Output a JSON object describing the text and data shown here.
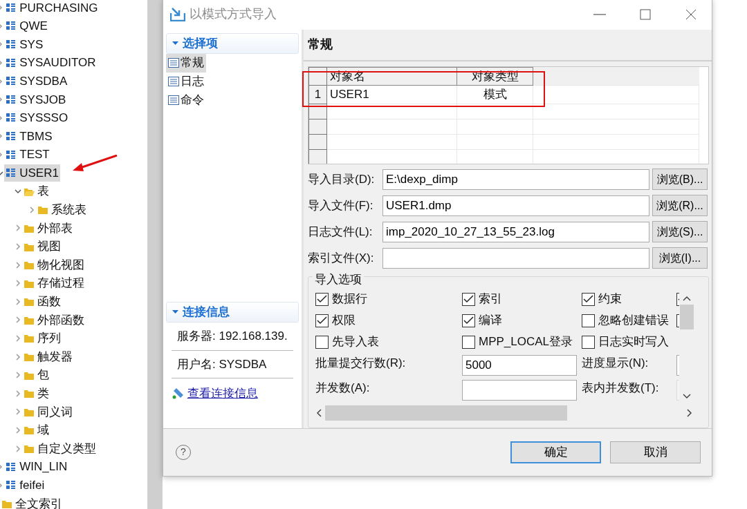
{
  "tree": [
    {
      "label": "PURCHASING",
      "kind": "schema",
      "expanded": false,
      "selected": false
    },
    {
      "label": "QWE",
      "kind": "schema",
      "expanded": false,
      "selected": false
    },
    {
      "label": "SYS",
      "kind": "schema",
      "expanded": false,
      "selected": false
    },
    {
      "label": "SYSAUDITOR",
      "kind": "schema",
      "expanded": false,
      "selected": false
    },
    {
      "label": "SYSDBA",
      "kind": "schema",
      "expanded": false,
      "selected": false
    },
    {
      "label": "SYSJOB",
      "kind": "schema",
      "expanded": false,
      "selected": false
    },
    {
      "label": "SYSSSO",
      "kind": "schema",
      "expanded": false,
      "selected": false
    },
    {
      "label": "TBMS",
      "kind": "schema",
      "expanded": false,
      "selected": false
    },
    {
      "label": "TEST",
      "kind": "schema",
      "expanded": false,
      "selected": false
    },
    {
      "label": "USER1",
      "kind": "schema",
      "expanded": true,
      "selected": true,
      "children": [
        {
          "label": "表",
          "kind": "folder",
          "expanded": true,
          "selected": false,
          "children": [
            {
              "label": "系统表",
              "kind": "folder",
              "expanded": false,
              "selected": false
            }
          ]
        },
        {
          "label": "外部表",
          "kind": "folder",
          "expanded": false,
          "selected": false
        },
        {
          "label": "视图",
          "kind": "folder",
          "expanded": false,
          "selected": false
        },
        {
          "label": "物化视图",
          "kind": "folder",
          "expanded": false,
          "selected": false
        },
        {
          "label": "存储过程",
          "kind": "folder",
          "expanded": false,
          "selected": false
        },
        {
          "label": "函数",
          "kind": "folder",
          "expanded": false,
          "selected": false
        },
        {
          "label": "外部函数",
          "kind": "folder",
          "expanded": false,
          "selected": false
        },
        {
          "label": "序列",
          "kind": "folder",
          "expanded": false,
          "selected": false
        },
        {
          "label": "触发器",
          "kind": "folder",
          "expanded": false,
          "selected": false
        },
        {
          "label": "包",
          "kind": "folder",
          "expanded": false,
          "selected": false
        },
        {
          "label": "类",
          "kind": "folder",
          "expanded": false,
          "selected": false
        },
        {
          "label": "同义词",
          "kind": "folder",
          "expanded": false,
          "selected": false
        },
        {
          "label": "域",
          "kind": "folder",
          "expanded": false,
          "selected": false
        },
        {
          "label": "自定义类型",
          "kind": "folder",
          "expanded": false,
          "selected": false
        }
      ]
    },
    {
      "label": "WIN_LIN",
      "kind": "schema",
      "expanded": false,
      "selected": false
    },
    {
      "label": "feifei",
      "kind": "schema",
      "expanded": false,
      "selected": false
    },
    {
      "label": "全文索引",
      "kind": "folder",
      "expanded": false,
      "selected": false
    }
  ],
  "dialog": {
    "title": "以模式方式导入",
    "nav_header": "选择项",
    "nav_items": [
      {
        "label": "常规",
        "selected": true
      },
      {
        "label": "日志",
        "selected": false
      },
      {
        "label": "命令",
        "selected": false
      }
    ],
    "connection_header": "连接信息",
    "connection_lines": [
      "服务器: 192.168.139.",
      "用户名: SYSDBA"
    ],
    "connection_link": "查看连接信息",
    "page_title": "常规",
    "table": {
      "columns": [
        "对象名",
        "对象类型"
      ],
      "rows": [
        {
          "index": "1",
          "cells": [
            "USER1",
            "模式"
          ]
        }
      ]
    },
    "paths": [
      {
        "label": "导入目录(D):",
        "value": "E:\\dexp_dimp",
        "button": "浏览(B)..."
      },
      {
        "label": "导入文件(F):",
        "value": "USER1.dmp",
        "button": "浏览(R)..."
      },
      {
        "label": "日志文件(L):",
        "value": "imp_2020_10_27_13_55_23.log",
        "button": "浏览(S)..."
      },
      {
        "label": "索引文件(X):",
        "button": "浏览(I)..."
      }
    ],
    "options_title": "导入选项",
    "checkboxes": [
      {
        "label": "数据行",
        "checked": true
      },
      {
        "label": "索引",
        "checked": true
      },
      {
        "label": "约束",
        "checked": true
      },
      {
        "checked": true
      },
      {
        "label": "权限",
        "checked": true
      },
      {
        "label": "编译",
        "checked": true
      },
      {
        "label": "忽略创建错误",
        "checked": false
      },
      {
        "checked": false
      },
      {
        "label": "先导入表",
        "checked": false
      },
      {
        "label": "MPP_LOCAL登录",
        "checked": false
      },
      {
        "label": "日志实时写入",
        "checked": false
      }
    ],
    "number_fields": [
      {
        "label": "批量提交行数(R):",
        "value": "5000"
      },
      {
        "label": "进度显示(N):"
      },
      {
        "label": "并发数(A):"
      },
      {
        "label": "表内并发数(T):",
        "disabled": true
      }
    ],
    "help": "?",
    "buttons": [
      {
        "label": "确定",
        "default": true
      },
      {
        "label": "取消",
        "default": false
      }
    ]
  }
}
